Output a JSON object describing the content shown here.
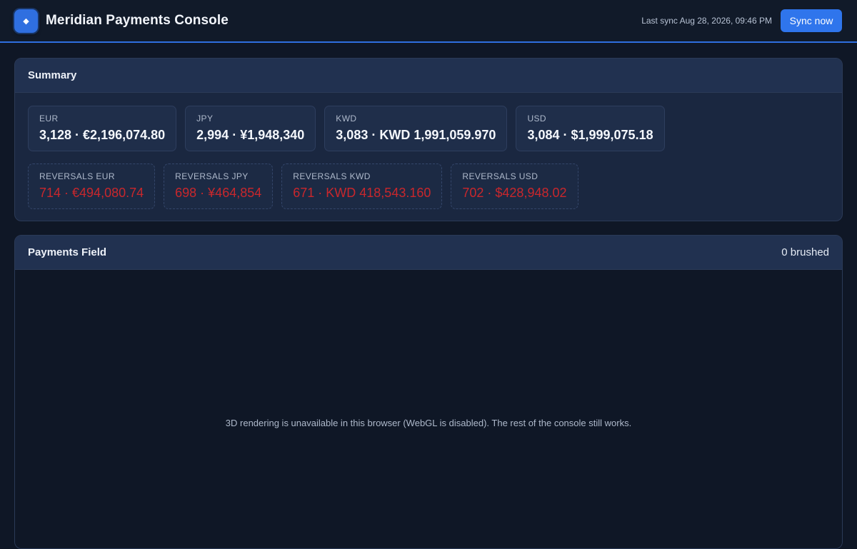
{
  "header": {
    "logo_glyph": "◆",
    "title": "Meridian Payments Console",
    "last_sync": "Last sync Aug 28, 2026, 09:46 PM",
    "sync_button_label": "Sync now"
  },
  "summary": {
    "title": "Summary",
    "totals": [
      {
        "label": "EUR",
        "value": "3,128 · €2,196,074.80"
      },
      {
        "label": "JPY",
        "value": "2,994 · ¥1,948,340"
      },
      {
        "label": "KWD",
        "value": "3,083 · KWD 1,991,059.970"
      },
      {
        "label": "USD",
        "value": "3,084 · $1,999,075.18"
      }
    ],
    "reversals": [
      {
        "label": "REVERSALS EUR",
        "value": "714 · €494,080.74"
      },
      {
        "label": "REVERSALS JPY",
        "value": "698 · ¥464,854"
      },
      {
        "label": "REVERSALS KWD",
        "value": "671 · KWD 418,543.160"
      },
      {
        "label": "REVERSALS USD",
        "value": "702 · $428,948.02"
      }
    ]
  },
  "payments_field": {
    "title": "Payments Field",
    "brushed": "0 brushed",
    "message": "3D rendering is unavailable in this browser (WebGL is disabled). The rest of the console still works."
  },
  "colors": {
    "accent": "#2f75ec",
    "background": "#0f1726",
    "panel": "#1a2740",
    "reversal_text": "#c9272c"
  }
}
